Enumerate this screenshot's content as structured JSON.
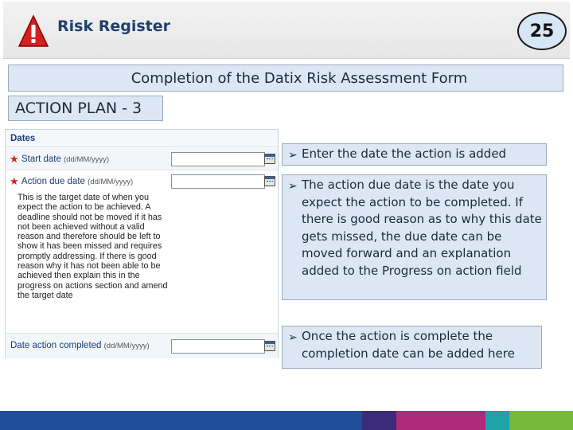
{
  "header": {
    "title": "Risk Register",
    "page_number": "25"
  },
  "banner": {
    "title": "Completion of the Datix Risk Assessment Form"
  },
  "section": {
    "label": "ACTION PLAN - 3"
  },
  "form": {
    "section_title": "Dates",
    "start_date": {
      "label": "Start date",
      "format": "(dd/MM/yyyy)"
    },
    "action_due_date": {
      "label": "Action due date",
      "format": "(dd/MM/yyyy)"
    },
    "help_text": "This is the target date of when you expect the action to be achieved. A deadline should not be moved if it has not been achieved without a valid reason and therefore should be left to show it has been missed and requires promptly addressing. If there is good reason why it has not been able to be achieved then explain this in the progress on actions section and amend the target date",
    "date_action_completed": {
      "label": "Date action completed",
      "format": "(dd/MM/yyyy)"
    }
  },
  "callouts": {
    "one": "Enter the date the action is added",
    "two": "The action due date is the date you expect the action to be completed. If there is good reason as to why this date gets missed, the due date can be moved forward and an explanation added to the Progress on action field",
    "three": "Once the action is complete the completion date can be added here"
  },
  "colors": {
    "header_title": "#1f3f6e",
    "warning_red": "#d42020",
    "callout_fill": "#dce7f3",
    "footer_stripe": [
      "#1f4e9a",
      "#3b2d7a",
      "#b02a7a",
      "#1fa3a8",
      "#78b83a"
    ]
  },
  "icons": [
    "warning-icon",
    "calendar-icon",
    "required-asterisk-icon",
    "arrow-bullet-icon"
  ]
}
